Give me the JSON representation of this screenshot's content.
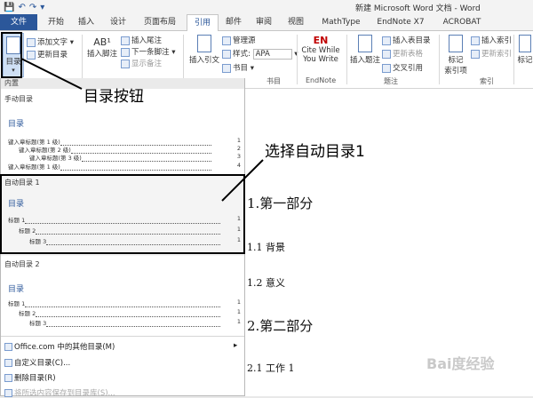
{
  "window": {
    "title": "新建 Microsoft Word 文档 - Word"
  },
  "qat": [
    "💾",
    "↶",
    "↷",
    "▾"
  ],
  "tabs": {
    "file": "文件",
    "home": "开始",
    "insert": "插入",
    "design": "设计",
    "layout": "页面布局",
    "references": "引用",
    "mailings": "邮件",
    "review": "审阅",
    "view": "视图",
    "mathtype": "MathType",
    "endnote": "EndNote X7",
    "acrobat": "ACROBAT"
  },
  "ribbon": {
    "toc": "目录",
    "add_text": "添加文字",
    "update_toc": "更新目录",
    "insert_footnote": "插入脚注",
    "insert_endnote": "插入尾注",
    "next_footnote": "下一条脚注",
    "show_notes": "显示备注",
    "insert_citation": "插入引文",
    "manage_sources": "管理源",
    "style_label": "样式:",
    "style_value": "APA",
    "bibliography": "书目",
    "group_citations": "书目",
    "cite_while": "Cite While",
    "you_write": "You Write",
    "group_endnote": "EndNote",
    "insert_caption": "插入题注",
    "insert_table_of_figures": "插入表目录",
    "update_table": "更新表格",
    "cross_reference": "交叉引用",
    "group_captions": "题注",
    "mark_entry": "标记",
    "mark_entry2": "索引项",
    "insert_index": "插入索引",
    "update_index": "更新索引",
    "group_index": "索引",
    "mark_citation": "标记"
  },
  "dropdown": {
    "header": "内置",
    "manual_label": "手动目录",
    "manual_title": "目录",
    "manual_lines": [
      "键入章标题(第 1 级)",
      "键入章标题(第 2 级)",
      "键入章标题(第 3 级)",
      "键入章标题(第 1 级)"
    ],
    "manual_pages": [
      "1",
      "2",
      "3",
      "4"
    ],
    "auto1_label": "自动目录 1",
    "auto1_title": "目录",
    "auto1_lines": [
      "标题 1",
      "标题 2",
      "标题 3"
    ],
    "auto1_pages": [
      "1",
      "1",
      "1"
    ],
    "auto2_label": "自动目录 2",
    "auto2_title": "目录",
    "auto2_lines": [
      "标题 1",
      "标题 2",
      "标题 3"
    ],
    "auto2_pages": [
      "1",
      "1",
      "1"
    ],
    "more_office": "Office.com 中的其他目录(M)",
    "custom_toc": "自定义目录(C)...",
    "remove_toc": "删除目录(R)",
    "save_selection": "将所选内容保存到目录库(S)..."
  },
  "annotations": {
    "toc_button": "目录按钮",
    "choose_auto": "选择自动目录1"
  },
  "document": {
    "h1a": "1.第一部分",
    "h2a": "1.1 背景",
    "h2b": "1.2 意义",
    "h1b": "2.第二部分",
    "h2c": "2.1 工作 1"
  },
  "watermark": "Bai度经验"
}
